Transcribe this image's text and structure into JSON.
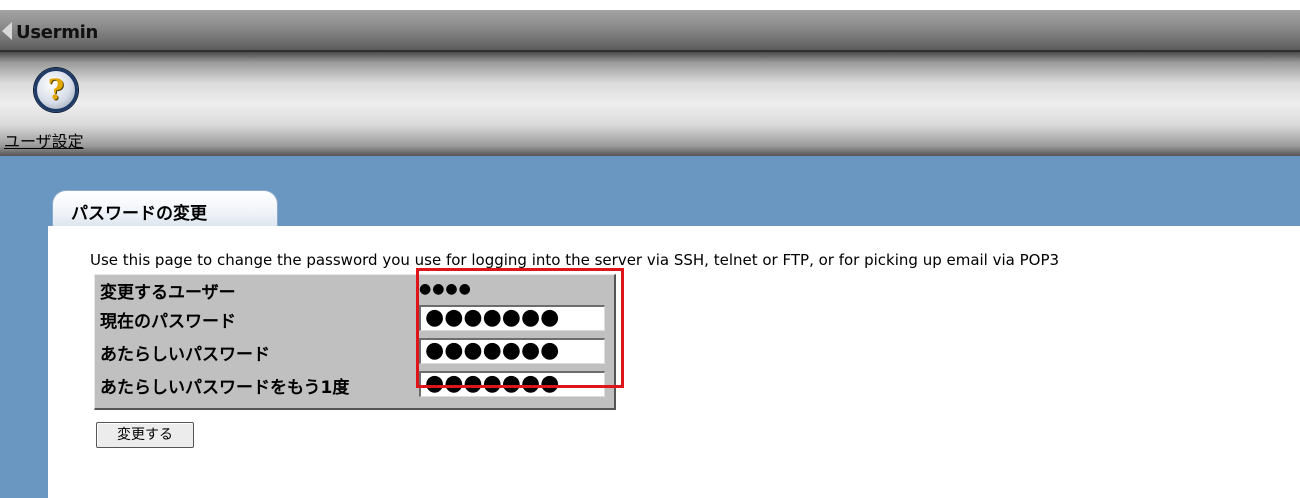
{
  "app": {
    "title": "Usermin"
  },
  "toolbar": {
    "icon": "help-icon",
    "link_label": "ユーザ設定"
  },
  "tab": {
    "title": "パスワードの変更"
  },
  "description": "Use this page to change the password you use for logging into the server via SSH, telnet or FTP, or for picking up email via POP3",
  "form": {
    "rows": [
      {
        "label": "変更するユーザー",
        "value": "●●●●"
      },
      {
        "label": "現在のパスワード",
        "value": "●●●●●●●"
      },
      {
        "label": "あたらしいパスワード",
        "value": "●●●●●●●"
      },
      {
        "label": "あたらしいパスワードをもう1度",
        "value": "●●●●●●●"
      }
    ],
    "submit_label": "変更する"
  },
  "colors": {
    "main_background": "#6a97c1",
    "form_background": "#c0c0c0",
    "highlight": "#e0141b"
  }
}
